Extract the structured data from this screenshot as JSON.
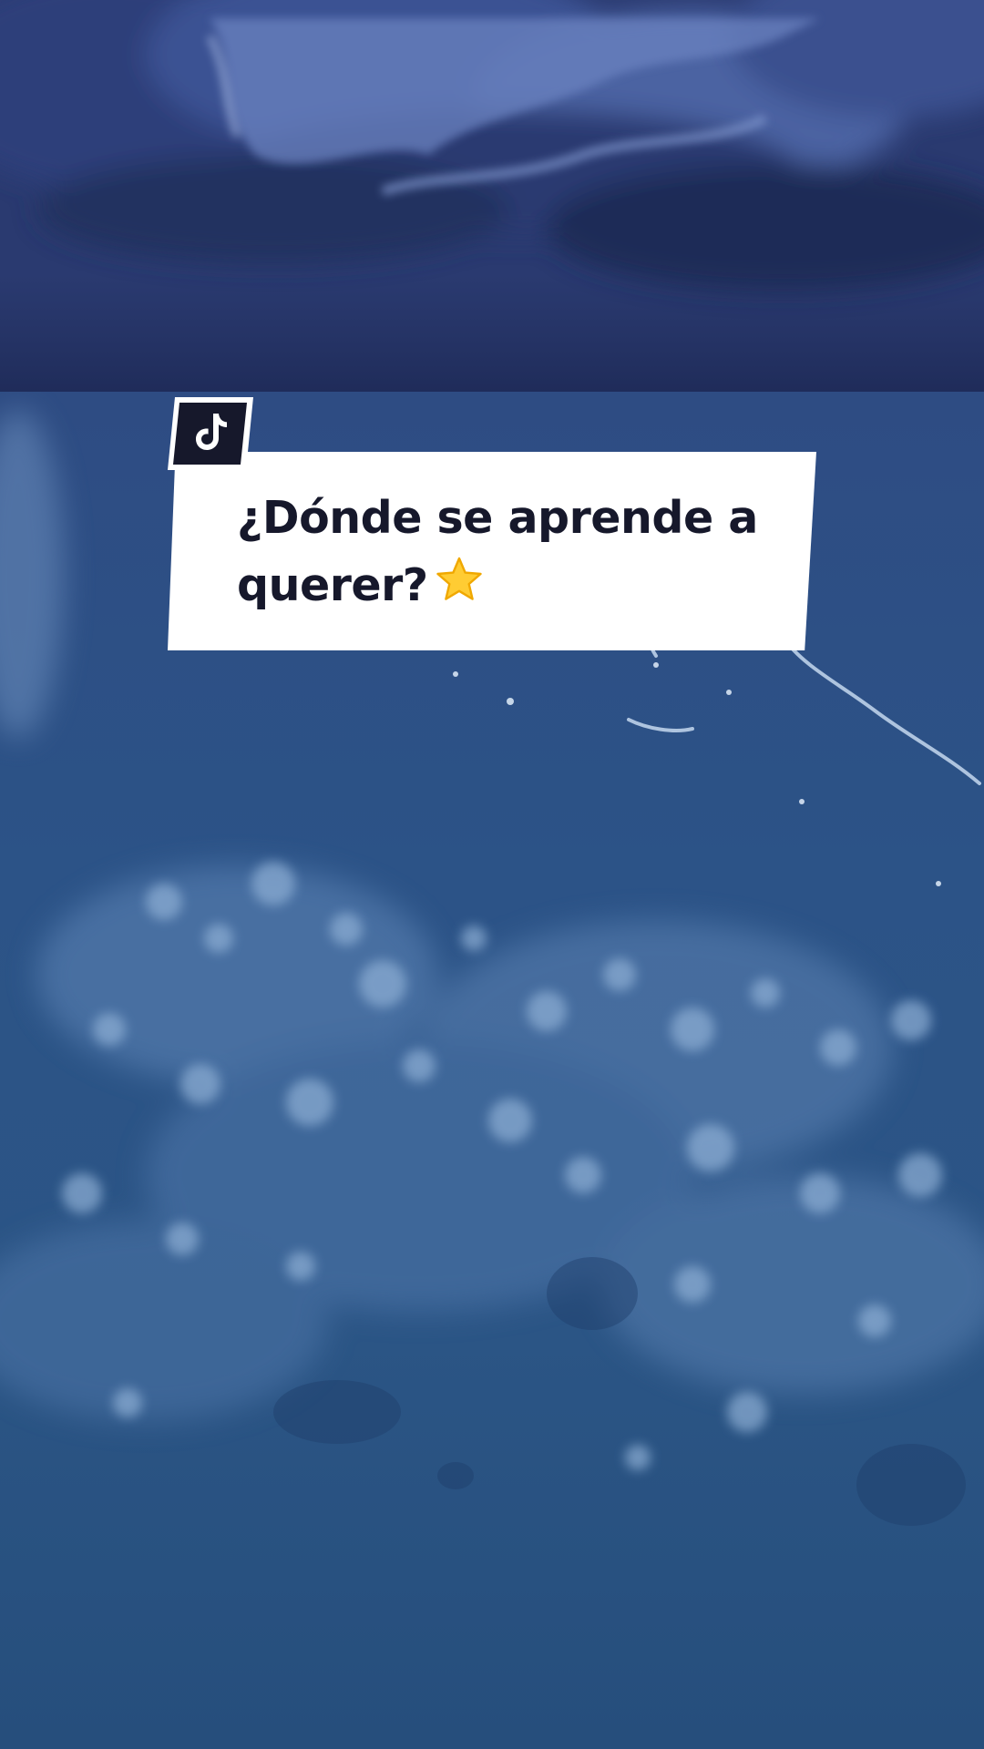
{
  "post": {
    "caption_text": "¿Dónde se aprende a querer?",
    "caption_emoji": "star-emoji"
  },
  "badge": {
    "icon": "tiktok-logo-icon"
  },
  "colors": {
    "card_background": "#ffffff",
    "caption_text": "#16182b",
    "badge_background": "#16182b",
    "sky_dark": "#1c2851",
    "sea_blue": "#2c4f85",
    "star_fill": "#ffcc33"
  }
}
